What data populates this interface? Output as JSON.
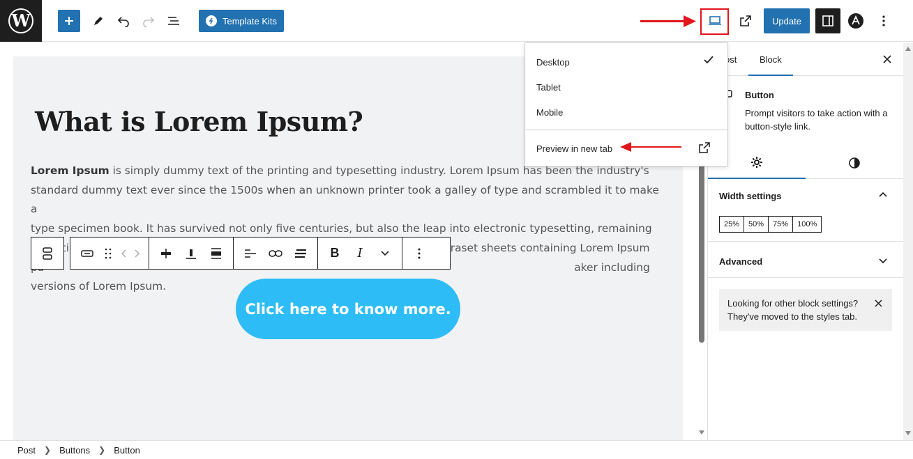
{
  "topbar": {
    "template_kits_label": "Template Kits",
    "update_label": "Update"
  },
  "content": {
    "heading": "What is Lorem Ipsum?",
    "para_bold": "Lorem Ipsum",
    "para_line1": " is simply dummy text of the printing and typesetting industry. Lorem Ipsum has been the industry's",
    "para_line2": "standard dummy text ever since the 1500s when an unknown printer took a galley of type and scrambled it to make a",
    "para_line3": "type specimen book. It has survived not only five centuries, but also the leap into electronic typesetting, remaining",
    "para_line4": "essentially unchanged. It was popularized in the 1960s with the release of Letraset sheets containing Lorem Ipsum",
    "para_line5_start": "pa",
    "para_line5_end": "aker including versions of Lorem Ipsum.",
    "button_label": "Click here to know more."
  },
  "preview_menu": {
    "items": [
      "Desktop",
      "Tablet",
      "Mobile"
    ],
    "selected": "Desktop",
    "preview_new_tab": "Preview in new tab"
  },
  "sidebar": {
    "tabs": [
      "Post",
      "Block"
    ],
    "tab_post_visible": "ost",
    "active_tab": "Block",
    "block_title": "Button",
    "block_description": "Prompt visitors to take action with a button-style link.",
    "width_settings_label": "Width settings",
    "width_options": [
      "25%",
      "50%",
      "75%",
      "100%"
    ],
    "advanced_label": "Advanced",
    "notice_text": "Looking for other block settings? They've moved to the styles tab."
  },
  "breadcrumb": [
    "Post",
    "Buttons",
    "Button"
  ],
  "colors": {
    "accent": "#2271b1",
    "cta": "#2dbcf5",
    "annotation": "#e0161c"
  }
}
